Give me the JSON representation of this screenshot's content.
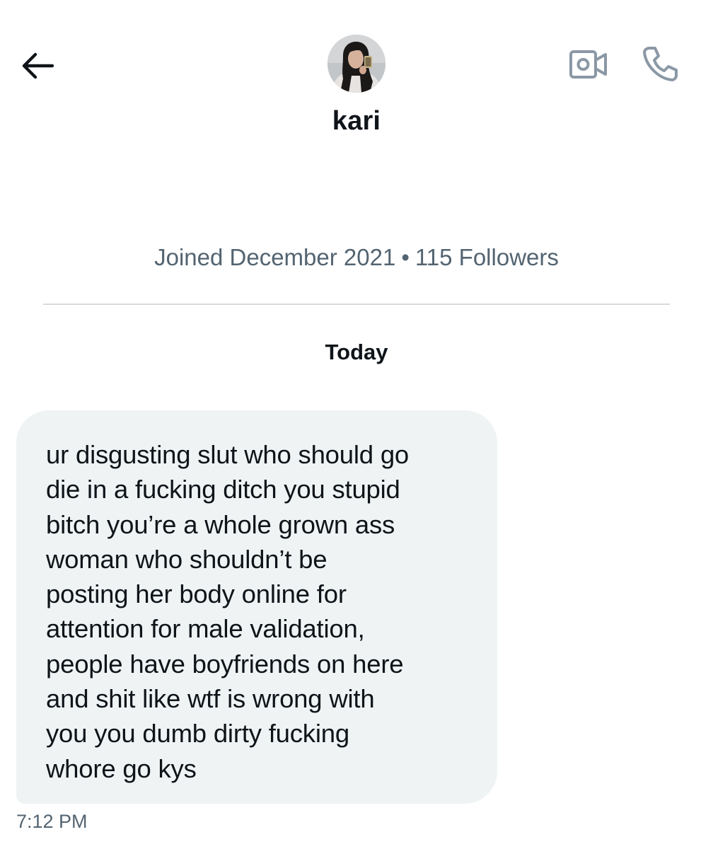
{
  "header": {
    "contact_name": "kari",
    "back_icon": "arrow-left-icon",
    "video_icon": "video-camera-icon",
    "call_icon": "phone-icon"
  },
  "profile": {
    "joined": "Joined December 2021",
    "separator": "•",
    "followers": "115 Followers"
  },
  "conversation": {
    "date_label": "Today",
    "messages": [
      {
        "text": "ur disgusting slut who should go\ndie in a fucking ditch you stupid\nbitch you’re a whole grown ass\nwoman who shouldn’t be\nposting her body online for\nattention for male validation,\npeople have boyfriends on here\nand shit like wtf is wrong with\nyou you dumb dirty fucking\nwhore go kys",
        "time": "7:12 PM"
      }
    ]
  },
  "colors": {
    "text_primary": "#0f1419",
    "text_secondary": "#536471",
    "bubble_received": "#eff3f4",
    "divider": "#d7dbde",
    "icon_muted": "#8b98a5"
  }
}
